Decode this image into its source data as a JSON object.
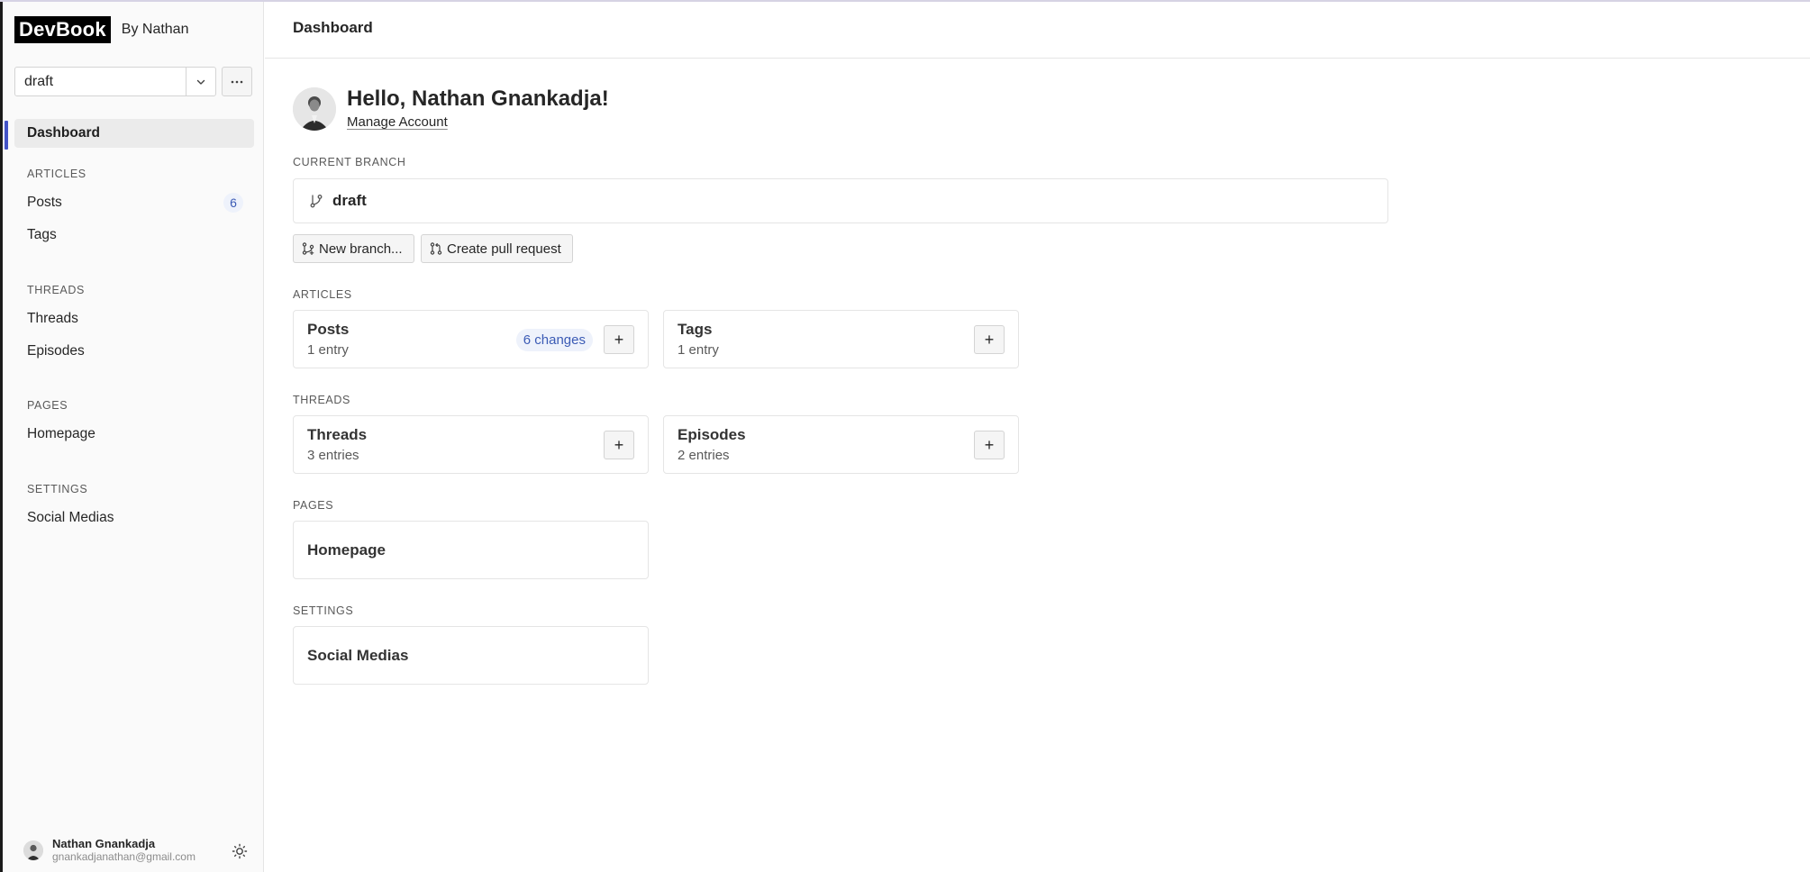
{
  "sidebar": {
    "brand": "DevBook",
    "by": "By Nathan",
    "branch_value": "draft",
    "nav": {
      "dashboard": "Dashboard",
      "articles_section": "ARTICLES",
      "posts": "Posts",
      "posts_badge": "6",
      "tags": "Tags",
      "threads_section": "THREADS",
      "threads": "Threads",
      "episodes": "Episodes",
      "pages_section": "PAGES",
      "homepage": "Homepage",
      "settings_section": "SETTINGS",
      "social_medias": "Social Medias"
    },
    "user": {
      "name": "Nathan Gnankadja",
      "email": "gnankadjanathan@gmail.com"
    }
  },
  "header": {
    "title": "Dashboard"
  },
  "main": {
    "greeting": "Hello, Nathan Gnankadja!",
    "manage_account": "Manage Account",
    "current_branch_label": "CURRENT BRANCH",
    "current_branch": "draft",
    "new_branch_button": "New branch...",
    "create_pr_button": "Create pull request",
    "sections": {
      "articles": "ARTICLES",
      "threads": "THREADS",
      "pages": "PAGES",
      "settings": "SETTINGS"
    },
    "cards": {
      "posts": {
        "title": "Posts",
        "sub": "1 entry",
        "changes": "6 changes"
      },
      "tags": {
        "title": "Tags",
        "sub": "1 entry"
      },
      "threads": {
        "title": "Threads",
        "sub": "3 entries"
      },
      "episodes": {
        "title": "Episodes",
        "sub": "2 entries"
      },
      "homepage": {
        "title": "Homepage"
      },
      "social_medias": {
        "title": "Social Medias"
      }
    }
  },
  "colors": {
    "accent": "#4353c6",
    "badge_bg": "#eef2fb",
    "badge_text": "#3b5bb5"
  },
  "icons": {
    "branch_dropdown": "chevron-down-icon",
    "more": "more-horizontal-icon",
    "theme": "sun-icon",
    "branch": "git-branch-icon",
    "pull_request": "git-pull-request-icon",
    "add": "plus-icon"
  }
}
